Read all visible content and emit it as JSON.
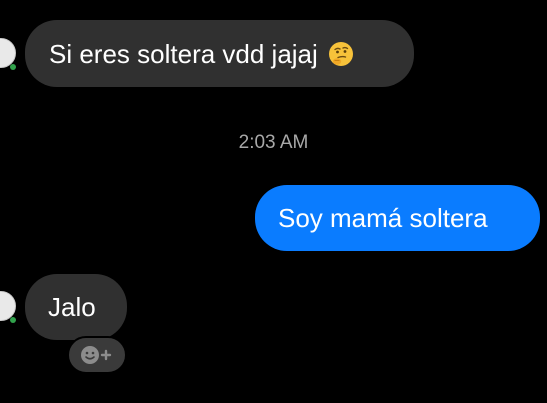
{
  "conversation": {
    "messages": [
      {
        "direction": "incoming",
        "text": "Si eres soltera vdd jajaj",
        "emoji": "thinking-face"
      },
      {
        "direction": "outgoing",
        "text": "Soy mamá soltera"
      },
      {
        "direction": "incoming",
        "text": "Jalo"
      }
    ],
    "timestamp": "2:03 AM",
    "reaction_button_icon": "add-reaction-icon"
  },
  "colors": {
    "background": "#000000",
    "incoming_bubble": "#303030",
    "outgoing_bubble": "#0a7cff",
    "timestamp_text": "#a8a8a8",
    "presence_dot": "#31a24c"
  }
}
